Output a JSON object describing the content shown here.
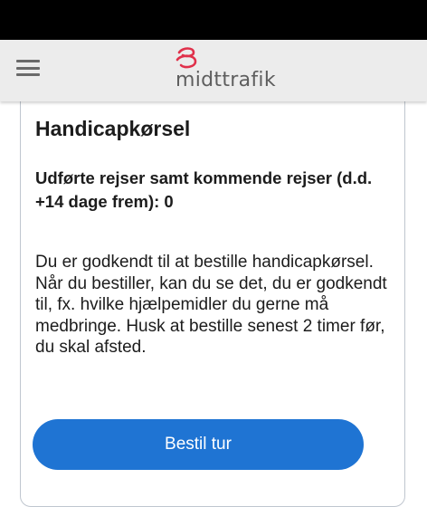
{
  "header": {
    "logo_text": "midttrafik",
    "logo_color": "#e0314b",
    "menu_icon": "hamburger-menu-icon"
  },
  "card": {
    "title": "Handicapkørsel",
    "subtitle": "Udførte rejser samt kommende rejser (d.d. +14 dage frem): 0",
    "body": "Du er godkendt til at bestille handicapkørsel. Når du bestiller, kan du se det, du er godkendt til, fx. hvilke hjælpemidler du gerne må medbringe. Husk at bestille senest 2 timer før, du skal afsted.",
    "button_label": "Bestil tur"
  },
  "colors": {
    "accent": "#1f74d3",
    "app_bar": "#ececec",
    "status_bar": "#000000"
  }
}
